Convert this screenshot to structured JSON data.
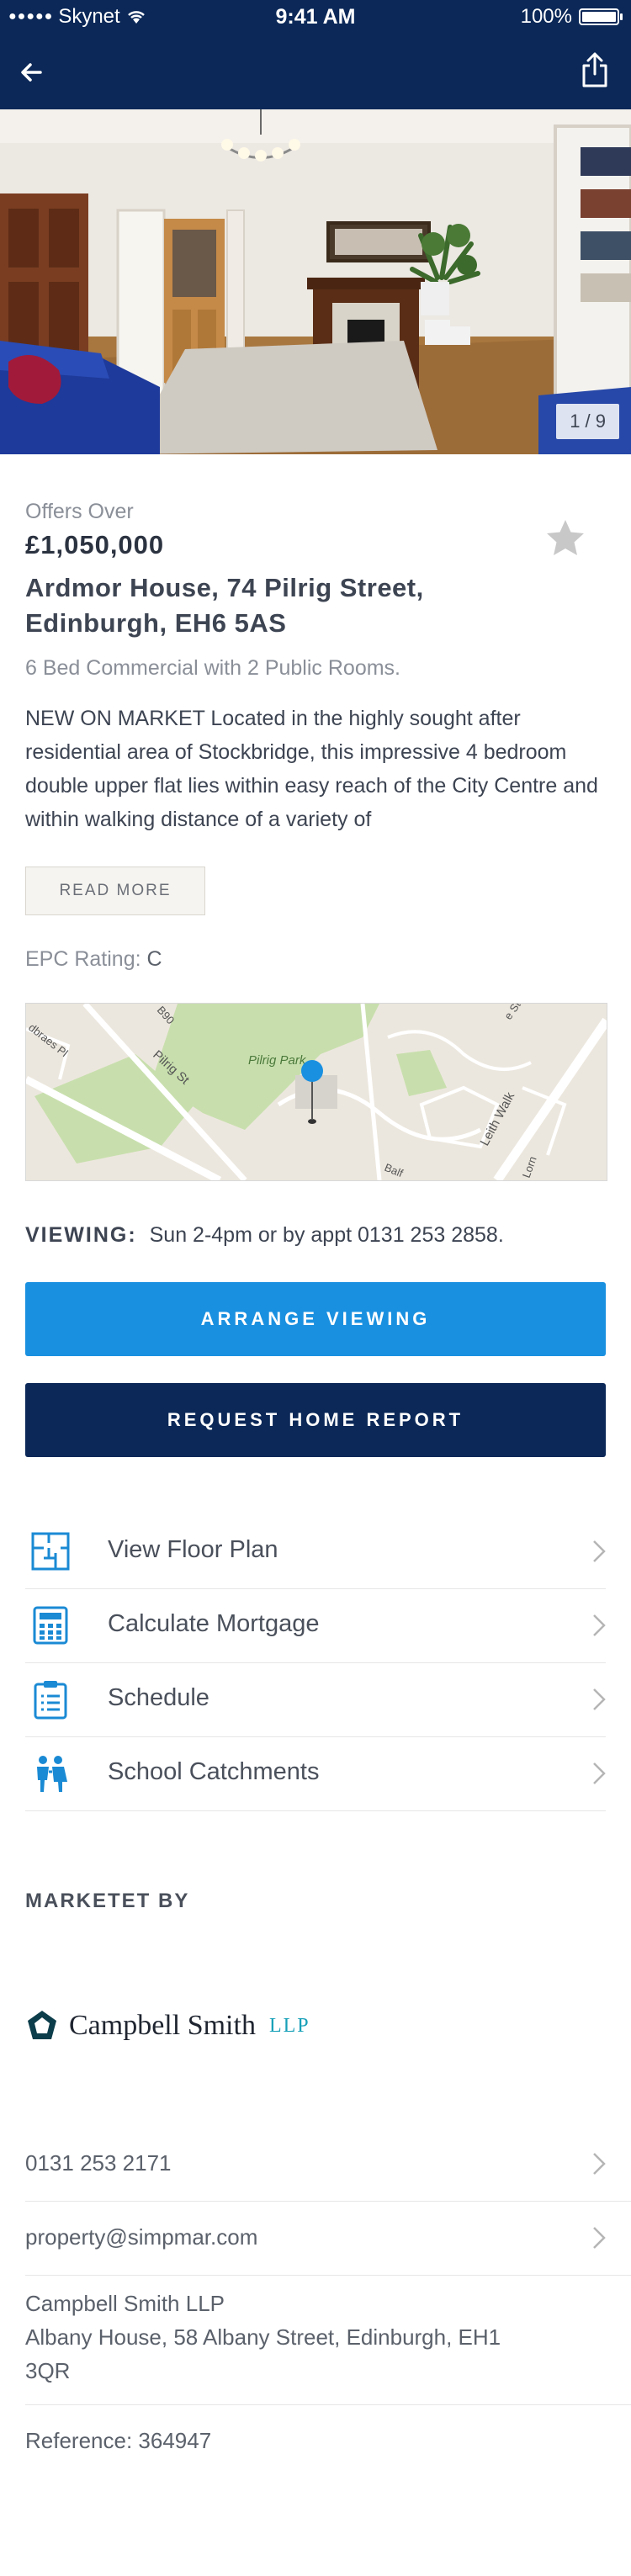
{
  "status_bar": {
    "carrier": "Skynet",
    "time": "9:41 AM",
    "battery": "100%"
  },
  "gallery": {
    "counter": "1 / 9"
  },
  "property": {
    "price_label": "Offers Over",
    "price": "£1,050,000",
    "address_line1": "Ardmor House, 74 Pilrig Street,",
    "address_line2": "Edinburgh, EH6 5AS",
    "summary": "6 Bed Commercial with 2 Public Rooms.",
    "description": "NEW ON MARKET Located in the highly sought after residential area of Stockbridge, this impressive 4 bedroom double upper flat lies within easy reach of the City Centre and within walking distance of a variety of",
    "read_more_label": "READ MORE",
    "epc_label": "EPC Rating:",
    "epc_value": "C"
  },
  "map": {
    "labels": [
      "Pilrig Park",
      "Pilrig St",
      "Leith Walk",
      "dbraes Pl",
      "B90",
      "Balf",
      "Lorn",
      "e St"
    ]
  },
  "viewing": {
    "label": "VIEWING:",
    "text": "Sun 2-4pm or by appt 0131 253 2858."
  },
  "buttons": {
    "arrange": "ARRANGE VIEWING",
    "report": "REQUEST HOME REPORT"
  },
  "links": [
    {
      "label": "View Floor Plan",
      "icon": "floor-plan-icon"
    },
    {
      "label": "Calculate Mortgage",
      "icon": "calculator-icon"
    },
    {
      "label": "Schedule",
      "icon": "clipboard-icon"
    },
    {
      "label": "School Catchments",
      "icon": "children-icon"
    }
  ],
  "agent": {
    "heading": "MARKETET BY",
    "logo_name": "Campbell Smith",
    "logo_suffix": "LLP",
    "phone": "0131 253 2171",
    "email": "property@simpmar.com",
    "company": "Campbell Smith LLP",
    "address_line1": "Albany House, 58 Albany Street, Edinburgh, EH1",
    "address_line2": "3QR",
    "reference": "Reference: 364947"
  },
  "colors": {
    "header": "#0b2858",
    "accent_blue": "#1a90e0",
    "navy": "#0b2858",
    "icon_blue": "#1a8ad4",
    "logo_teal": "#17a0b8"
  }
}
